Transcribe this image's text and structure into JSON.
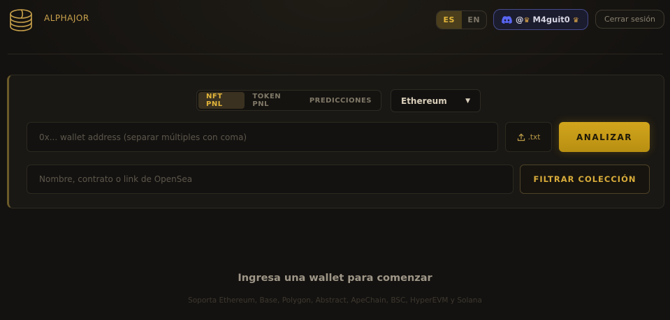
{
  "brand": {
    "name": "ALPHAJOR",
    "logo_icon": "coin-stack-logo-icon"
  },
  "header": {
    "languages": [
      {
        "code": "ES",
        "active": true
      },
      {
        "code": "EN",
        "active": false
      }
    ],
    "account": {
      "icon": "discord-icon",
      "prefix": "@",
      "username": "M4guit0"
    },
    "logout_label": "Cerrar sesión"
  },
  "analyzer": {
    "modes": [
      {
        "label": "NFT PNL",
        "active": true
      },
      {
        "label": "TOKEN PNL",
        "active": false
      },
      {
        "label": "PREDICCIONES",
        "active": false
      }
    ],
    "chain": {
      "selected": "Ethereum",
      "arrow": "▼"
    },
    "wallet_input": {
      "value": "",
      "placeholder": "0x... wallet address (separar múltiples con coma)"
    },
    "upload": {
      "icon": "upload-icon",
      "label": ".txt"
    },
    "analyze_label": "ANALIZAR",
    "collection_input": {
      "value": "",
      "placeholder": "Nombre, contrato o link de OpenSea"
    },
    "filter_label": "FILTRAR COLECCIÓN"
  },
  "empty_state": {
    "title": "Ingresa una wallet para comenzar",
    "subtitle": "Soporta Ethereum, Base, Polygon, Abstract, ApeChain, BSC, HyperEVM y Solana"
  },
  "colors": {
    "background": "#141210",
    "accent": "#d1a51c",
    "accent_text": "#e3b53a",
    "discord": "#5865f2"
  }
}
